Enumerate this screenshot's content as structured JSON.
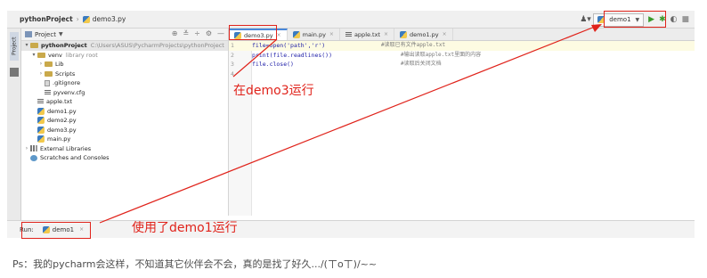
{
  "breadcrumb": {
    "project": "pythonProject",
    "file": "demo3.py"
  },
  "toolbar": {
    "run_config": "demo1"
  },
  "project_panel": {
    "header": "Project",
    "tree": [
      {
        "label": "pythonProject",
        "extra": "C:\\Users\\ASUS\\PycharmProjects\\pythonProject"
      },
      {
        "label": "venv",
        "extra": "library root"
      },
      {
        "label": "Lib"
      },
      {
        "label": "Scripts"
      },
      {
        "label": ".gitignore"
      },
      {
        "label": "pyvenv.cfg"
      },
      {
        "label": "apple.txt"
      },
      {
        "label": "demo1.py"
      },
      {
        "label": "demo2.py"
      },
      {
        "label": "demo3.py"
      },
      {
        "label": "main.py"
      },
      {
        "label": "External Libraries"
      },
      {
        "label": "Scratches and Consoles"
      }
    ]
  },
  "editor": {
    "tabs": [
      "demo3.py",
      "main.py",
      "apple.txt",
      "demo1.py"
    ],
    "lines": [
      {
        "num": "1",
        "code": "file=open('path','r')",
        "comment": "#读取已有文件apple.txt"
      },
      {
        "num": "2",
        "code": "print(file.readlines())",
        "comment": "#输出读取apple.txt里面的内容"
      },
      {
        "num": "3",
        "code": "file.close()",
        "comment": "#读取后关闭文档"
      },
      {
        "num": "4",
        "code": "",
        "comment": ""
      }
    ]
  },
  "run_bar": {
    "label": "Run:",
    "tab": "demo1"
  },
  "annotations": {
    "top": "在demo3运行",
    "bottom": "使用了demo1运行",
    "color": "#e0231b"
  },
  "caption": "Ps：我的pycharm会这样，不知道其它伙伴会不会，真的是找了好久.../(ㄒoㄒ)/~~"
}
